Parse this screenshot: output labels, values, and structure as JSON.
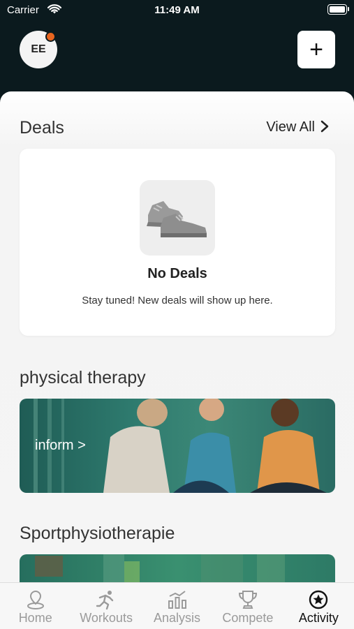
{
  "status_bar": {
    "carrier": "Carrier",
    "time": "11:49 AM"
  },
  "header": {
    "avatar_initials": "EE",
    "add_label": "+"
  },
  "deals": {
    "title": "Deals",
    "view_all": "View All",
    "empty_title": "No Deals",
    "empty_subtitle": "Stay tuned! New deals will show up here."
  },
  "sections": [
    {
      "title": "physical therapy",
      "link": "inform >"
    },
    {
      "title": "Sportphysiotherapie"
    }
  ],
  "tabs": [
    {
      "label": "Home",
      "icon": "home-pin-icon"
    },
    {
      "label": "Workouts",
      "icon": "runner-icon"
    },
    {
      "label": "Analysis",
      "icon": "bar-chart-icon"
    },
    {
      "label": "Compete",
      "icon": "trophy-icon"
    },
    {
      "label": "Activity",
      "icon": "star-badge-icon",
      "active": true
    }
  ],
  "colors": {
    "header_bg": "#0b1a1e",
    "notification_dot": "#e8651f",
    "banner_teal": "#2e7a6e"
  }
}
